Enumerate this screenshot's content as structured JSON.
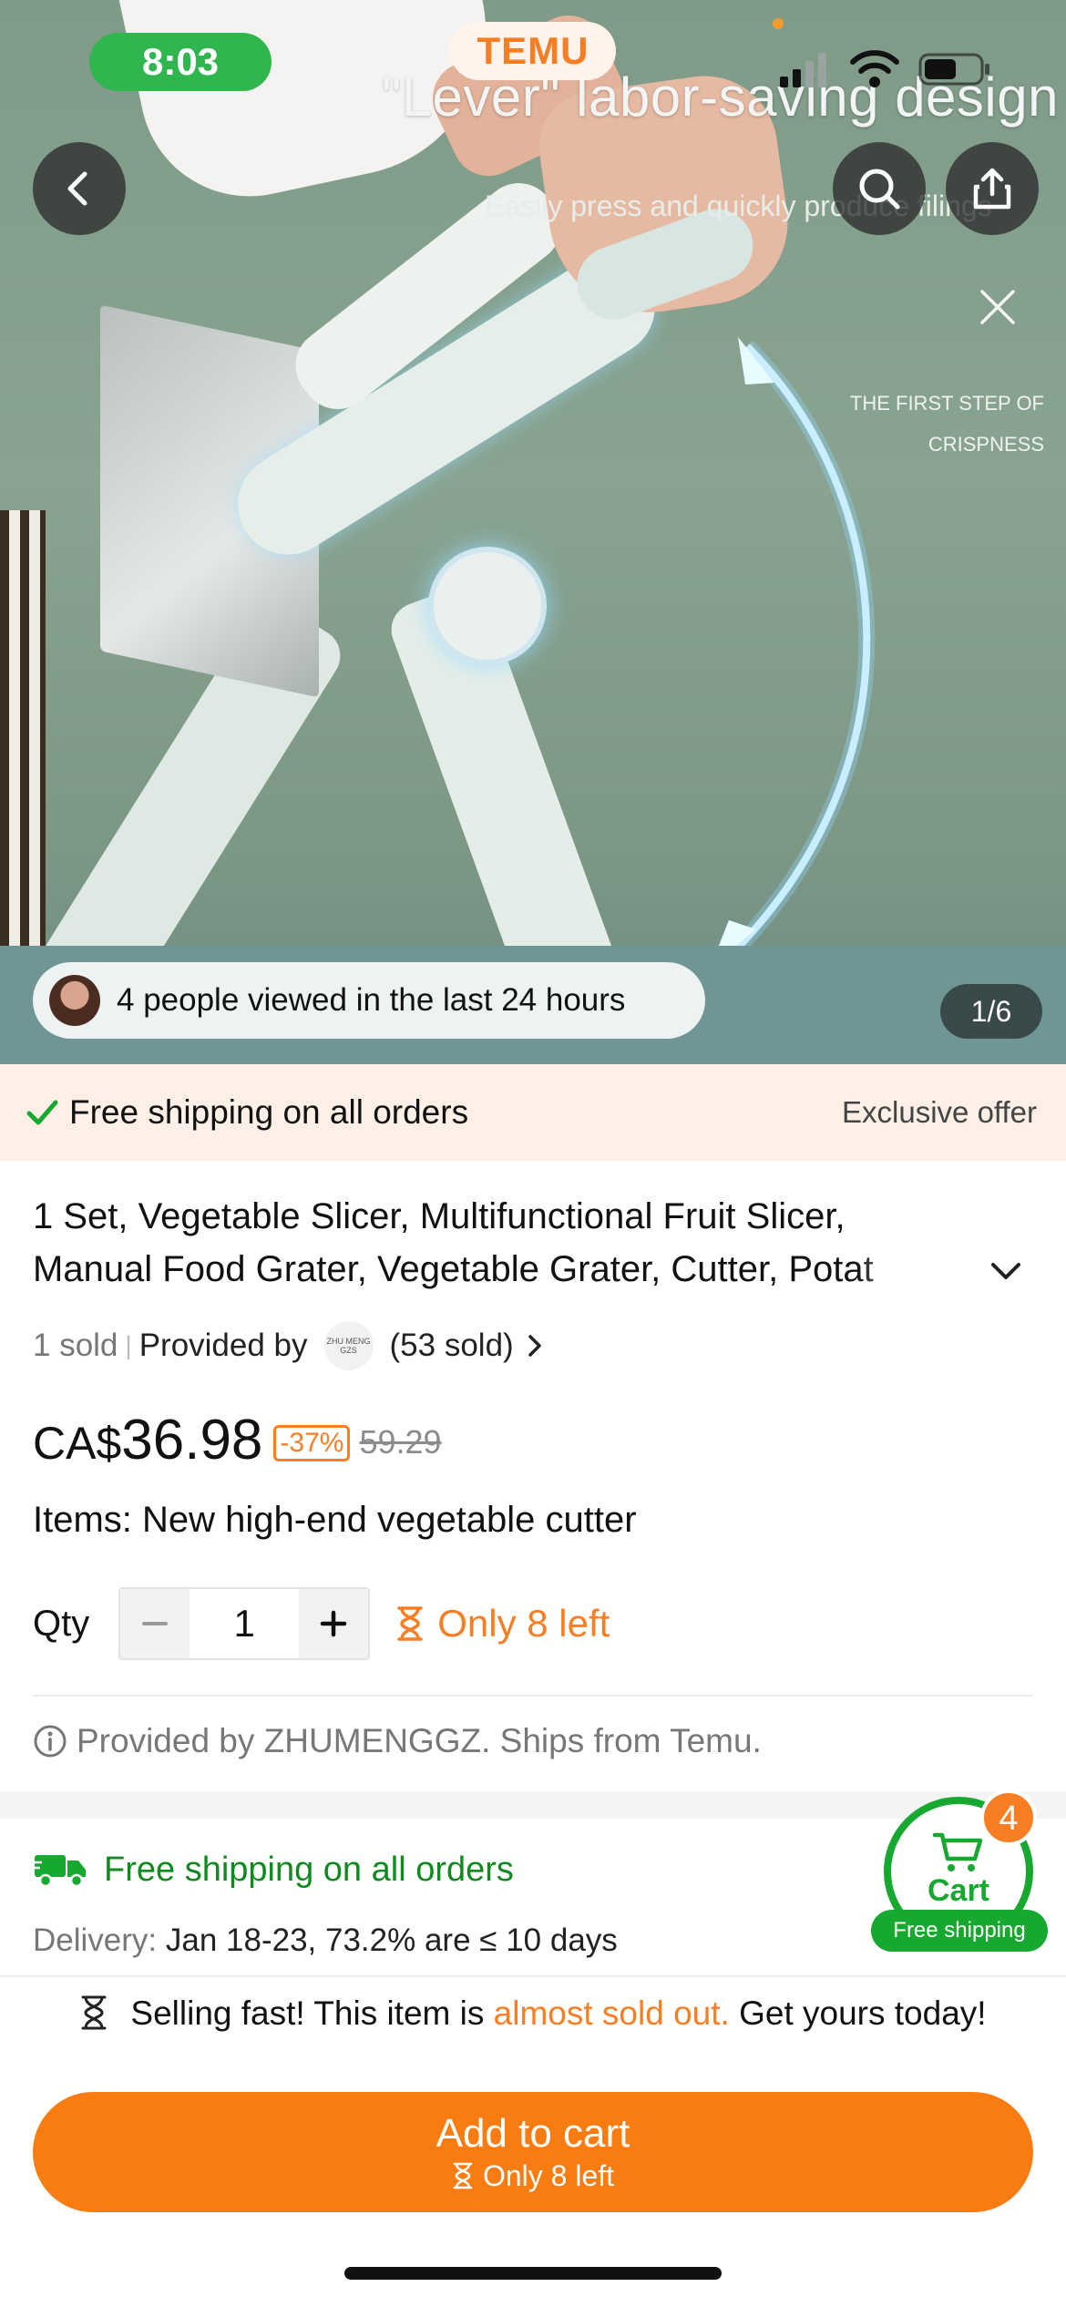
{
  "status_bar": {
    "time": "8:03"
  },
  "brand": {
    "logo_text": "TEMU"
  },
  "hero": {
    "headline": "\"Lever\" labor-saving design",
    "subline": "Easily press and quickly produce filings",
    "side_note": "THE FIRST STEP OF CRISPNESS",
    "viewers_text": "4 people viewed in the last 24 hours",
    "image_counter": "1/6"
  },
  "shipping_banner": {
    "text": "Free shipping on all orders",
    "offer": "Exclusive offer"
  },
  "product": {
    "title": "1 Set, Vegetable Slicer, Multifunctional Fruit Slicer,\nManual Food Grater, Vegetable Grater, Cutter, Potat",
    "sold": "1 sold",
    "provided_by_label": "Provided by",
    "store_logo_text": "ZHU MENG GZS",
    "store_sold": "(53 sold)",
    "price_currency": "CA$",
    "price_amount": "36.98",
    "discount": "-37%",
    "original_price": "59.29",
    "items_label": "Items: New high-end vegetable cutter",
    "qty_label": "Qty",
    "qty_value": "1",
    "stock_text": "Only 8 left",
    "provider_note": "Provided by ZHUMENGGZ. Ships from Temu."
  },
  "delivery": {
    "free_shipping": "Free shipping on all orders",
    "label": "Delivery:",
    "value": "Jan 18-23, 73.2% are ≤ 10 days"
  },
  "cart_fab": {
    "label": "Cart",
    "count": "4",
    "pill": "Free shipping"
  },
  "urgency": {
    "prefix": "Selling fast! This item is ",
    "highlight": "almost sold out.",
    "suffix": " Get yours today!"
  },
  "add_to_cart": {
    "label": "Add to cart",
    "sub": "Only 8 left"
  },
  "colors": {
    "accent": "#f97c12",
    "green": "#17a82f",
    "banner_bg": "#fef0e6"
  },
  "icons": [
    "back-icon",
    "search-icon",
    "share-icon",
    "close-icon",
    "check-icon",
    "chevron-down-icon",
    "chevron-right-icon",
    "minus-icon",
    "plus-icon",
    "hourglass-icon",
    "info-icon",
    "truck-icon",
    "cart-icon"
  ]
}
